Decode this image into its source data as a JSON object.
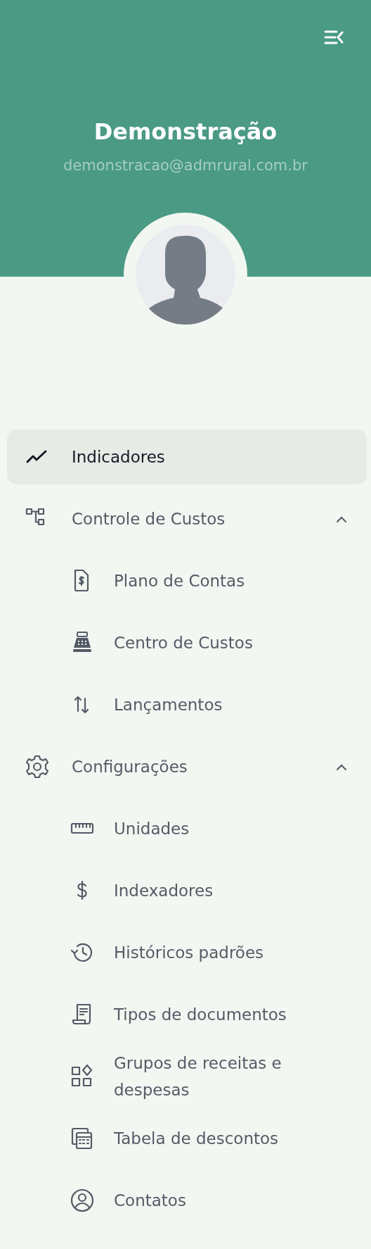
{
  "header": {
    "title": "Demonstração",
    "email": "demonstracao@admrural.com.br"
  },
  "menu": [
    {
      "label": "Indicadores",
      "selected": true
    },
    {
      "label": "Controle de Custos",
      "selected": false,
      "expanded": true,
      "children": [
        {
          "label": "Plano de Contas",
          "selected": false
        },
        {
          "label": "Centro de Custos",
          "selected": false
        },
        {
          "label": "Lançamentos",
          "selected": false
        }
      ]
    },
    {
      "label": "Configurações",
      "selected": false,
      "expanded": true,
      "children": [
        {
          "label": "Unidades",
          "selected": false
        },
        {
          "label": "Indexadores",
          "selected": false
        },
        {
          "label": "Históricos padrões",
          "selected": false
        },
        {
          "label": "Tipos de documentos",
          "selected": false
        },
        {
          "label": "Grupos de receitas e despesas",
          "selected": false
        },
        {
          "label": "Tabela de descontos",
          "selected": false
        },
        {
          "label": "Contatos",
          "selected": false
        }
      ]
    }
  ]
}
